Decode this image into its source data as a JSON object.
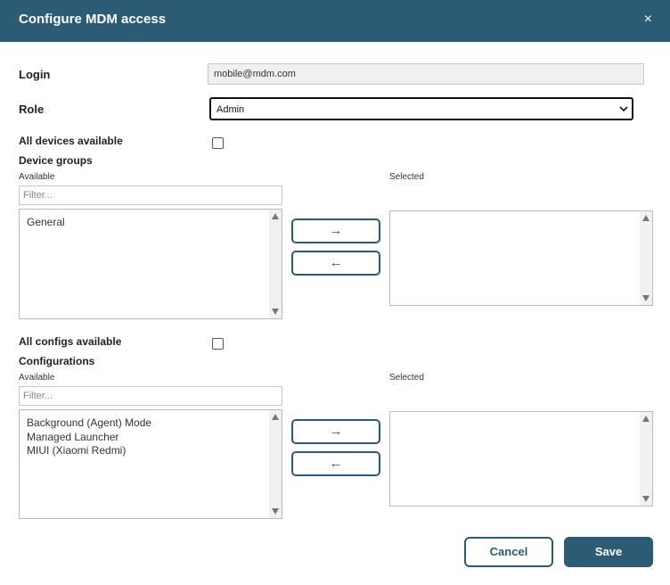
{
  "dialog": {
    "title": "Configure MDM access",
    "close_glyph": "×"
  },
  "login": {
    "label": "Login",
    "value": "mobile@mdm.com"
  },
  "role": {
    "label": "Role",
    "selected": "Admin"
  },
  "device_section": {
    "all_label": "All devices available",
    "all_checked": false,
    "groups_label": "Device groups",
    "available_label": "Available",
    "selected_label": "Selected",
    "filter_placeholder": "Filter...",
    "available_items": [
      "General"
    ],
    "selected_items": [],
    "add_glyph": "→",
    "remove_glyph": "←"
  },
  "config_section": {
    "all_label": "All configs available",
    "all_checked": false,
    "configs_label": "Configurations",
    "available_label": "Available",
    "selected_label": "Selected",
    "filter_placeholder": "Filter...",
    "available_items": [
      "Background (Agent) Mode",
      "Managed Launcher",
      "MIUI (Xiaomi Redmi)"
    ],
    "selected_items": [],
    "add_glyph": "→",
    "remove_glyph": "←"
  },
  "footer": {
    "cancel_label": "Cancel",
    "save_label": "Save"
  },
  "colors": {
    "header_bg": "#2c5b76",
    "accent": "#2c5b76"
  }
}
